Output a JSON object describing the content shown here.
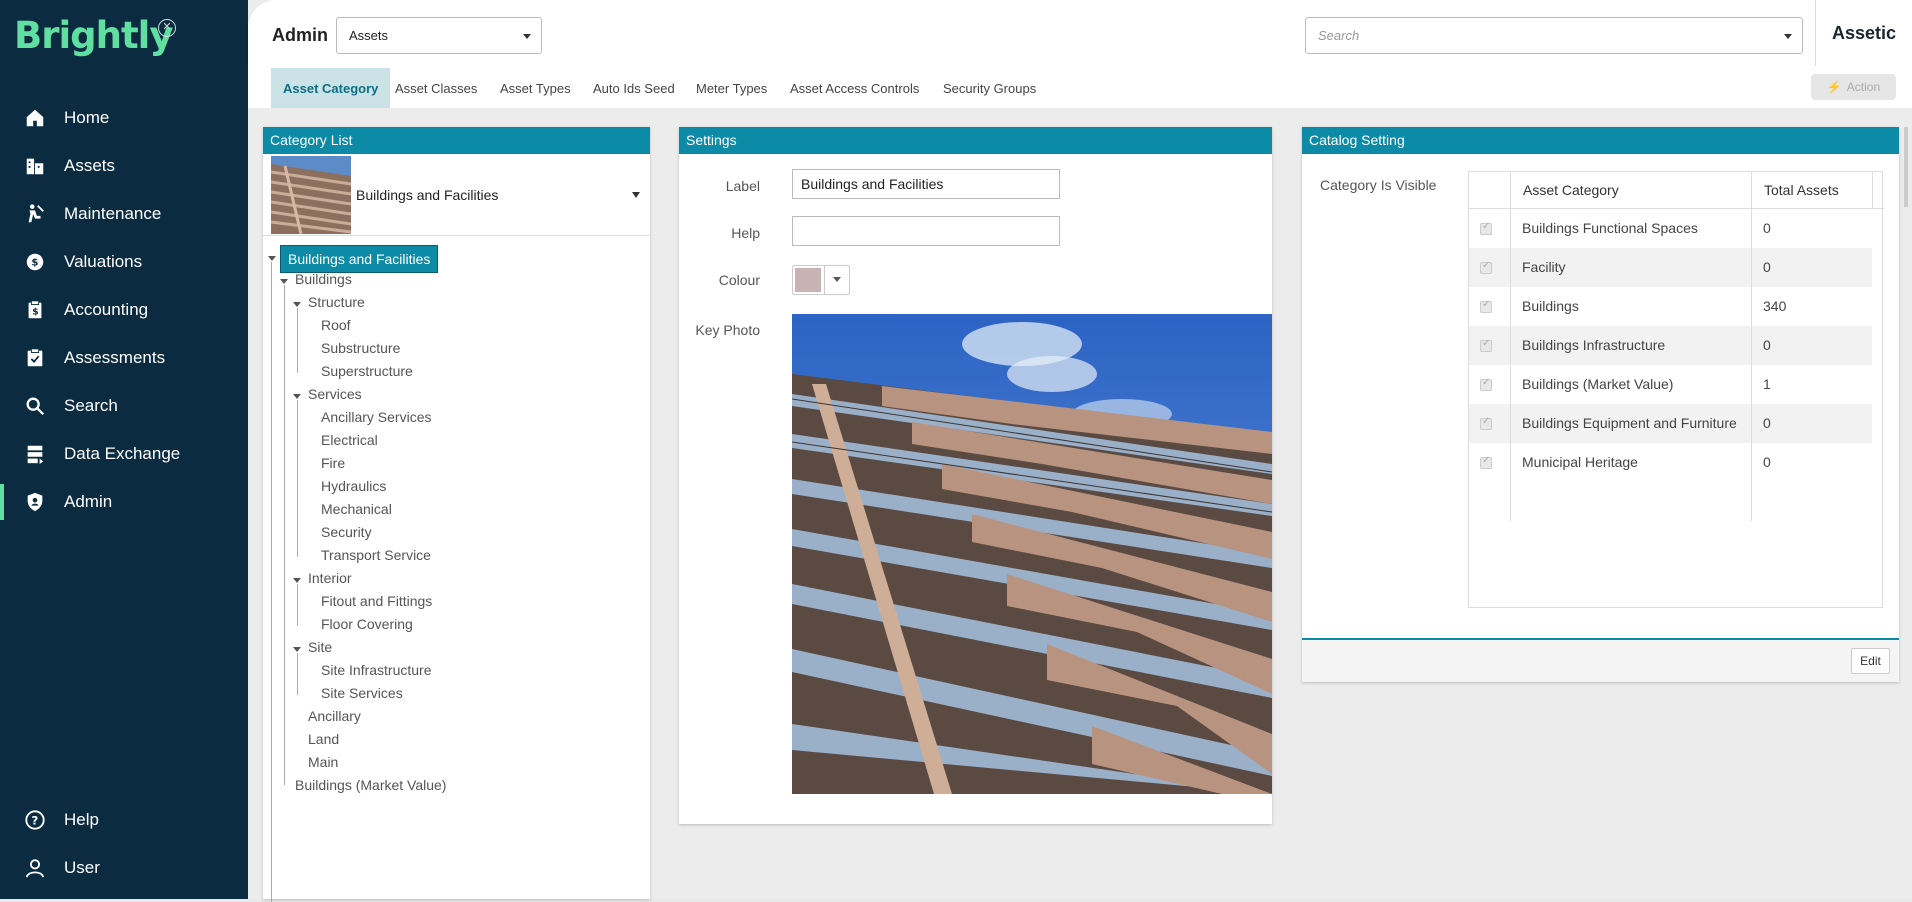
{
  "brand": {
    "logo": "Brightly",
    "close_icon": "close-circle-icon"
  },
  "nav": {
    "items": [
      {
        "label": "Home",
        "icon": "home-icon"
      },
      {
        "label": "Assets",
        "icon": "assets-icon"
      },
      {
        "label": "Maintenance",
        "icon": "maintenance-icon"
      },
      {
        "label": "Valuations",
        "icon": "valuations-icon"
      },
      {
        "label": "Accounting",
        "icon": "accounting-icon"
      },
      {
        "label": "Assessments",
        "icon": "assessments-icon"
      },
      {
        "label": "Search",
        "icon": "search-icon"
      },
      {
        "label": "Data Exchange",
        "icon": "data-exchange-icon"
      },
      {
        "label": "Admin",
        "icon": "admin-icon",
        "active": true
      }
    ],
    "bottom": [
      {
        "label": "Help",
        "icon": "help-icon"
      },
      {
        "label": "User",
        "icon": "user-icon"
      }
    ]
  },
  "header": {
    "title": "Admin",
    "module_select": "Assets",
    "search_placeholder": "Search",
    "brand_right": "Assetic"
  },
  "tabs": [
    "Asset Category",
    "Asset Classes",
    "Asset Types",
    "Auto Ids Seed",
    "Meter Types",
    "Asset Access Controls",
    "Security Groups"
  ],
  "action_label": "Action",
  "category_list": {
    "title": "Category List",
    "selected": "Buildings and Facilities",
    "tree_root": "Buildings and Facilities",
    "tree": [
      "Buildings",
      "Structure",
      "Roof",
      "Substructure",
      "Superstructure",
      "Services",
      "Ancillary Services",
      "Electrical",
      "Fire",
      "Hydraulics",
      "Mechanical",
      "Security",
      "Transport Service",
      "Interior",
      "Fitout and Fittings",
      "Floor Covering",
      "Site",
      "Site Infrastructure",
      "Site Services",
      "Ancillary",
      "Land",
      "Main",
      "Buildings (Market Value)"
    ]
  },
  "settings": {
    "title": "Settings",
    "label_label": "Label",
    "label_value": "Buildings and Facilities",
    "help_label": "Help",
    "help_value": "",
    "colour_label": "Colour",
    "colour_value": "#c9b2b3",
    "key_photo_label": "Key Photo"
  },
  "catalog": {
    "title": "Catalog Setting",
    "visible_label": "Category Is Visible",
    "columns": [
      "Asset Category",
      "Total Assets"
    ],
    "rows": [
      {
        "category": "Buildings Functional Spaces",
        "total": "0"
      },
      {
        "category": "Facility",
        "total": "0"
      },
      {
        "category": "Buildings",
        "total": "340"
      },
      {
        "category": "Buildings Infrastructure",
        "total": "0"
      },
      {
        "category": "Buildings (Market Value)",
        "total": "1"
      },
      {
        "category": "Buildings Equipment and Furniture",
        "total": "0"
      },
      {
        "category": "Municipal Heritage",
        "total": "0"
      }
    ],
    "edit_label": "Edit"
  }
}
